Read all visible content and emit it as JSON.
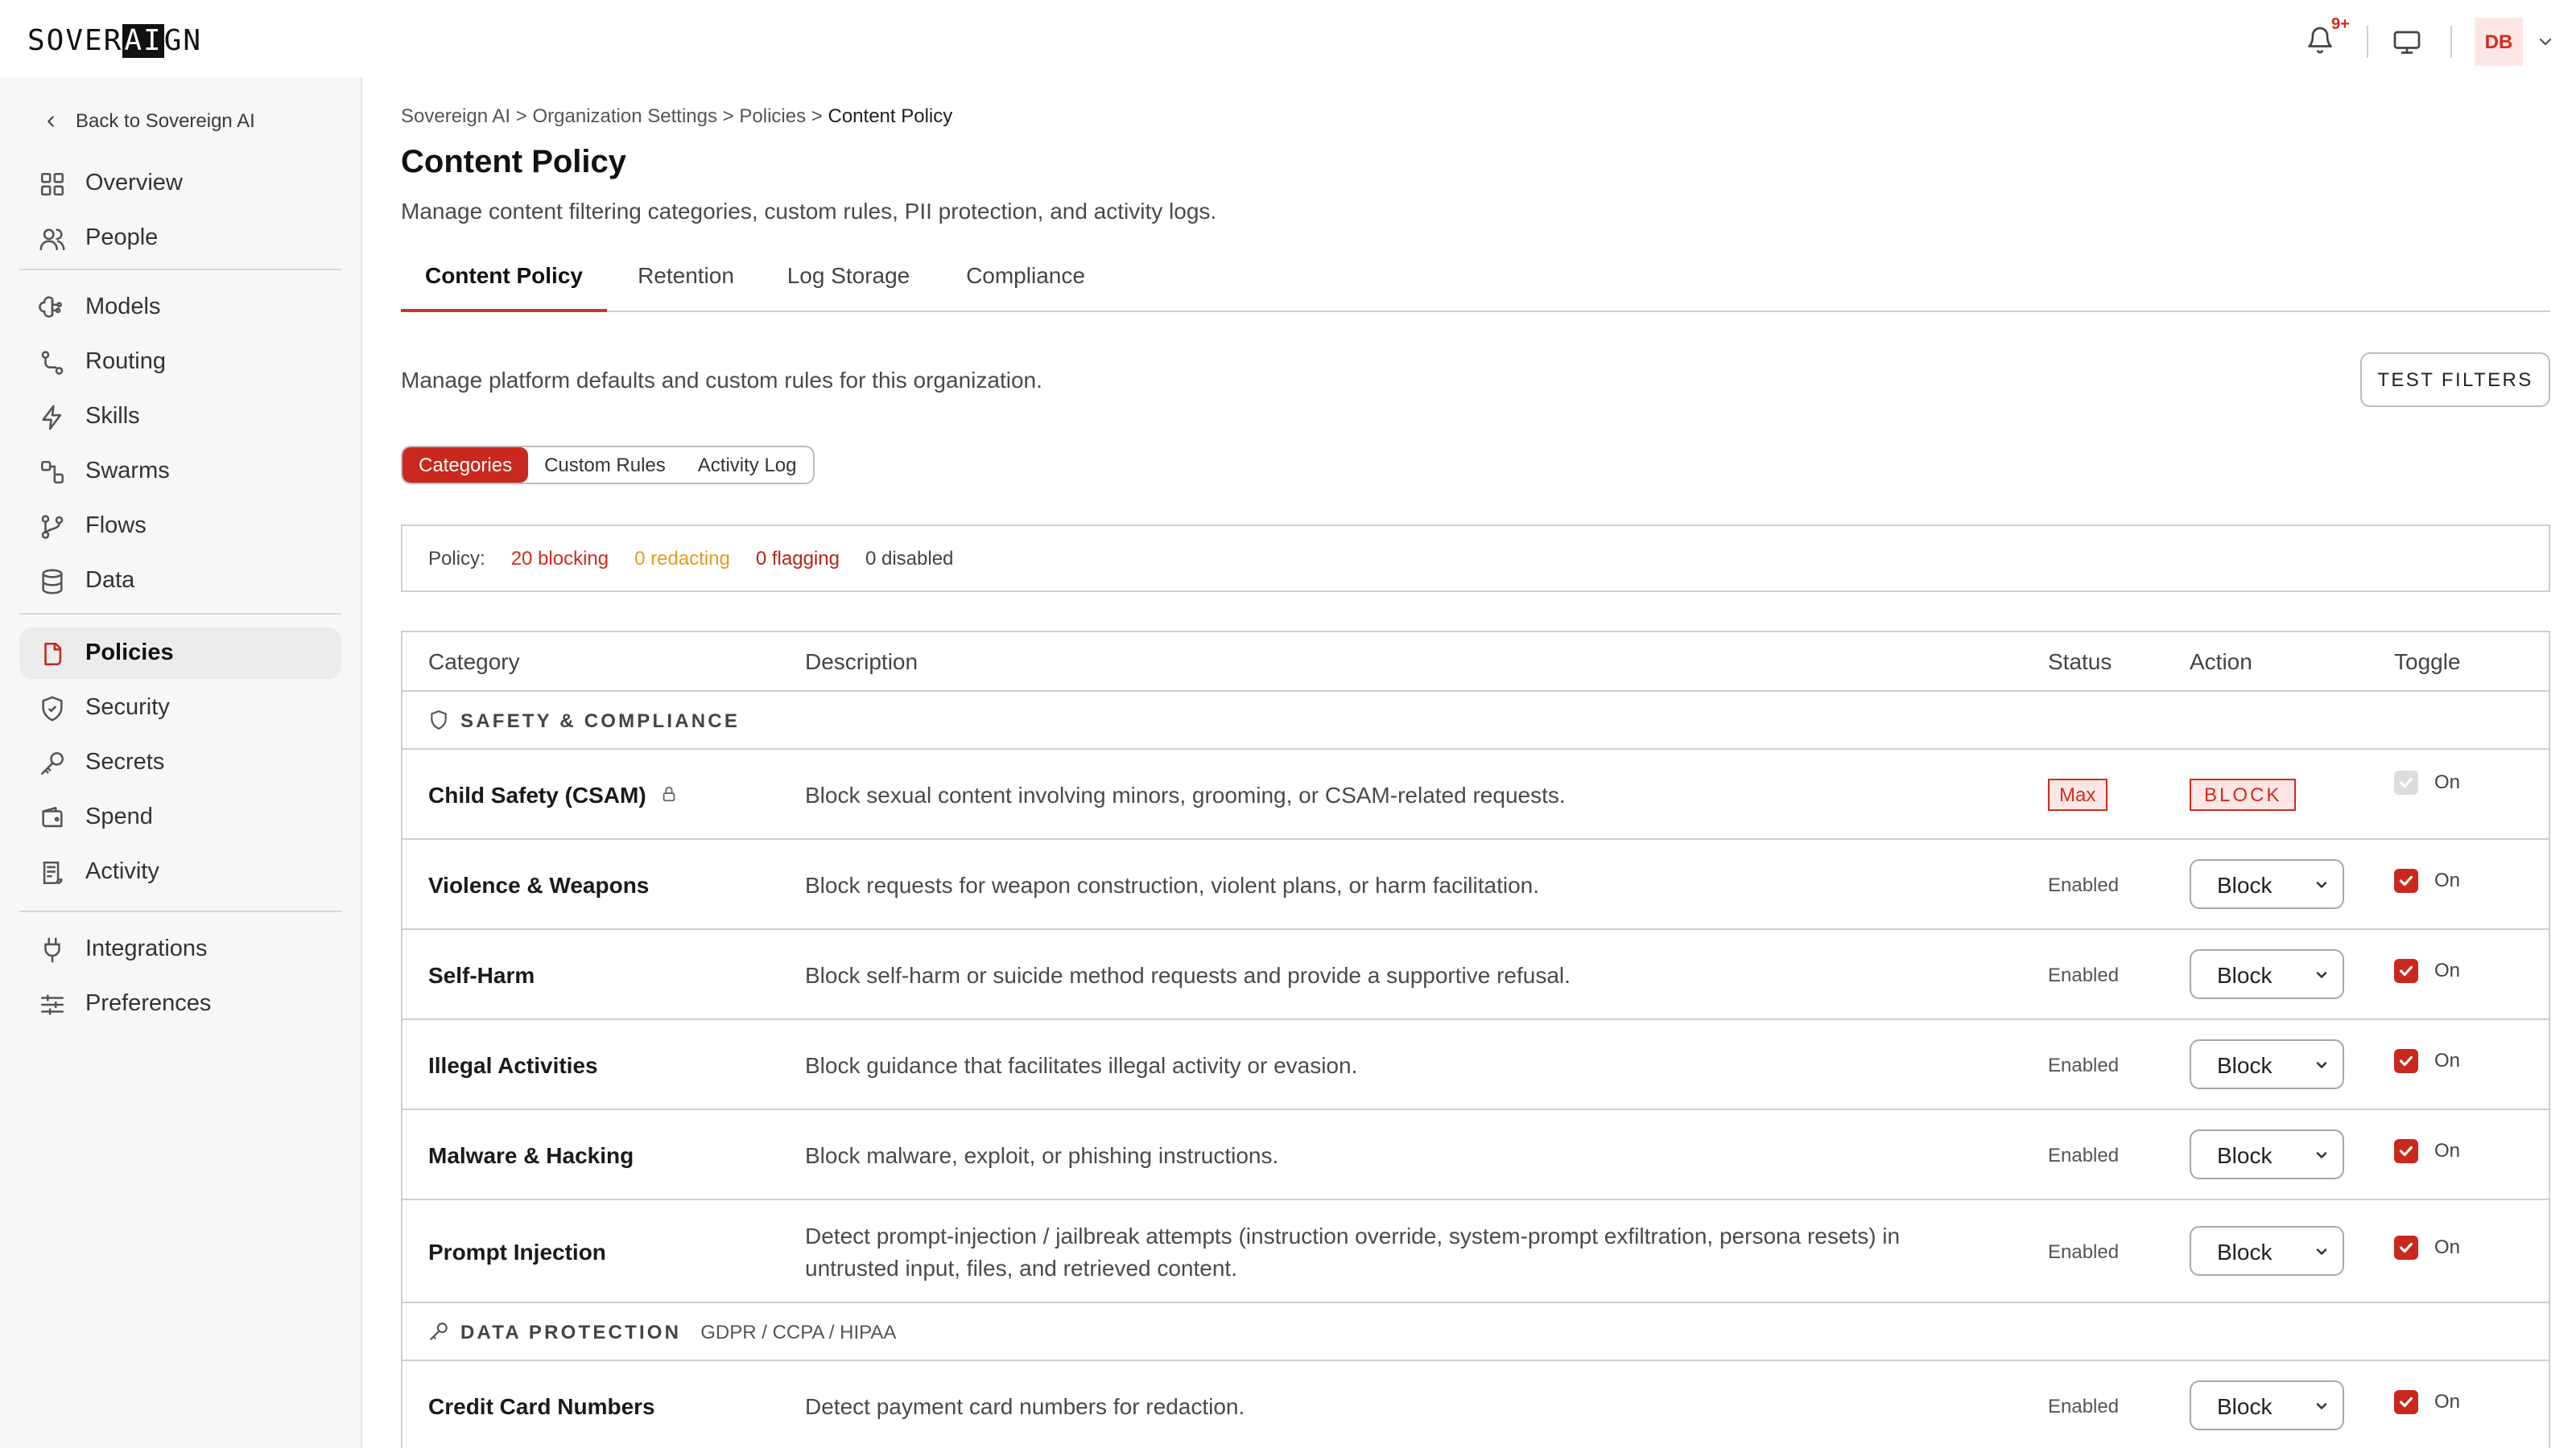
{
  "app": {
    "logo_pre": "SOVER",
    "logo_inv": "AI",
    "logo_post": "GN",
    "notifications": "9+",
    "user_initials": "DB"
  },
  "sidebar": {
    "back": "Back to Sovereign AI",
    "groups": [
      [
        {
          "label": "Overview",
          "icon": "grid-icon"
        },
        {
          "label": "People",
          "icon": "people-icon"
        }
      ],
      [
        {
          "label": "Models",
          "icon": "brain-icon"
        },
        {
          "label": "Routing",
          "icon": "route-icon"
        },
        {
          "label": "Skills",
          "icon": "bolt-icon"
        },
        {
          "label": "Swarms",
          "icon": "swarm-icon"
        },
        {
          "label": "Flows",
          "icon": "branch-icon"
        },
        {
          "label": "Data",
          "icon": "database-icon"
        }
      ],
      [
        {
          "label": "Policies",
          "icon": "document-icon",
          "active": true
        },
        {
          "label": "Security",
          "icon": "shield-icon"
        },
        {
          "label": "Secrets",
          "icon": "key-icon"
        },
        {
          "label": "Spend",
          "icon": "wallet-icon"
        },
        {
          "label": "Activity",
          "icon": "log-icon"
        }
      ],
      [
        {
          "label": "Integrations",
          "icon": "plug-icon"
        },
        {
          "label": "Preferences",
          "icon": "sliders-icon"
        }
      ]
    ]
  },
  "breadcrumb": {
    "items": [
      "Sovereign AI",
      "Organization Settings",
      "Policies"
    ],
    "current": "Content Policy",
    "separator": ">"
  },
  "page": {
    "title": "Content Policy",
    "subtitle": "Manage content filtering categories, custom rules, PII protection, and activity logs."
  },
  "tabs": [
    {
      "label": "Content Policy",
      "active": true
    },
    {
      "label": "Retention"
    },
    {
      "label": "Log Storage"
    },
    {
      "label": "Compliance"
    }
  ],
  "section": {
    "description": "Manage platform defaults and custom rules for this organization.",
    "test_button": "TEST FILTERS"
  },
  "segments": [
    {
      "label": "Categories",
      "active": true
    },
    {
      "label": "Custom Rules"
    },
    {
      "label": "Activity Log"
    }
  ],
  "policy_summary": {
    "label": "Policy:",
    "blocking": "20 blocking",
    "redacting": "0 redacting",
    "flagging": "0 flagging",
    "disabled": "0 disabled"
  },
  "table": {
    "headers": {
      "category": "Category",
      "description": "Description",
      "status": "Status",
      "action": "Action",
      "toggle": "Toggle"
    },
    "sections": [
      {
        "label": "SAFETY & COMPLIANCE",
        "sub": "",
        "icon": "shield-icon",
        "rows": [
          {
            "name": "Child Safety (CSAM)",
            "description": "Block sexual content involving minors, grooming, or CSAM-related requests.",
            "status": "Max",
            "action": "BLOCK",
            "locked": true,
            "toggle": "On"
          },
          {
            "name": "Violence & Weapons",
            "description": "Block requests for weapon construction, violent plans, or harm facilitation.",
            "status": "Enabled",
            "action": "Block",
            "toggle": "On"
          },
          {
            "name": "Self-Harm",
            "description": "Block self-harm or suicide method requests and provide a supportive refusal.",
            "status": "Enabled",
            "action": "Block",
            "toggle": "On"
          },
          {
            "name": "Illegal Activities",
            "description": "Block guidance that facilitates illegal activity or evasion.",
            "status": "Enabled",
            "action": "Block",
            "toggle": "On"
          },
          {
            "name": "Malware & Hacking",
            "description": "Block malware, exploit, or phishing instructions.",
            "status": "Enabled",
            "action": "Block",
            "toggle": "On"
          },
          {
            "name": "Prompt Injection",
            "description": "Detect prompt-injection / jailbreak attempts (instruction override, system-prompt exfiltration, persona resets) in untrusted input, files, and retrieved content.",
            "status": "Enabled",
            "action": "Block",
            "toggle": "On",
            "tall": true
          }
        ]
      },
      {
        "label": "DATA PROTECTION",
        "sub": "GDPR / CCPA / HIPAA",
        "icon": "key-icon",
        "rows": [
          {
            "name": "Credit Card Numbers",
            "description": "Detect payment card numbers for redaction.",
            "status": "Enabled",
            "action": "Block",
            "toggle": "On"
          }
        ]
      }
    ]
  },
  "colors": {
    "accent": "#c8281d",
    "warning": "#e59a1c",
    "badge_bg": "#fde7e5"
  }
}
